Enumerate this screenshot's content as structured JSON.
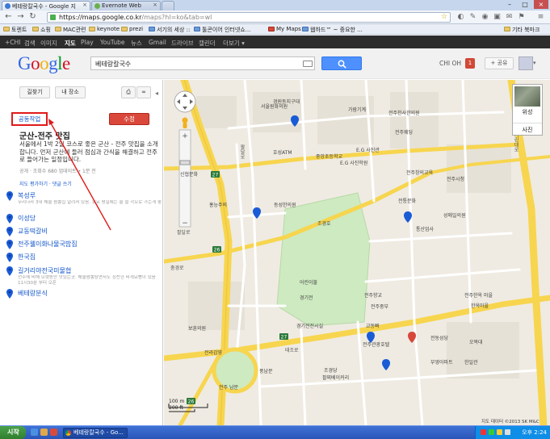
{
  "browser": {
    "tabs": [
      {
        "label": "베테랑칼국수 - Google 지",
        "close": "×"
      },
      {
        "label": "Evernote Web",
        "close": "×"
      }
    ],
    "url_host": "https://maps.google.co.kr",
    "url_path": "/maps?hl=ko&tab=wl",
    "bookmarks": [
      "토렌트",
      "쇼핑",
      "MAC관련",
      "keynote",
      "prezi",
      "서기의 세상 ::",
      "툴콘이어 인터넷쇼...",
      "My Maps",
      "웹하드™ ~ 중요한 ...",
      "기타 북마크"
    ],
    "window_controls": {
      "min": "–",
      "max": "□",
      "close": "×"
    }
  },
  "google_bar": {
    "items": [
      "+CHI",
      "검색",
      "이미지",
      "지도",
      "Play",
      "YouTube",
      "뉴스",
      "Gmail",
      "드라이브",
      "캘린더",
      "더보기 ▾"
    ],
    "active": "지도"
  },
  "header": {
    "logo_letters": [
      "G",
      "o",
      "o",
      "g",
      "l",
      "e"
    ],
    "logo_colors": [
      "#3369e8",
      "#d50f25",
      "#eeb211",
      "#3369e8",
      "#009925",
      "#d50f25"
    ],
    "search_value": "베테랑칼국수",
    "user_name": "CHI OH",
    "notif_count": "1",
    "share_label": "+ 공유"
  },
  "panel": {
    "directions_label": "길찾기",
    "myplaces_label": "내 장소",
    "collab_label": "공동작업",
    "edit_label": "수정",
    "title": "군산-전주 맛집",
    "description": "서울에서 1박 2일 코스로 좋은 군산 - 전주 맛집을 소개합니다. 먼저 군산에 들러 점심과 간식을 해결하고 전주로 들어가는 일정입니다.",
    "meta": "공개 · 조회수 680 업데이트 • 1분 전",
    "links": "지도 평가하기 · 댓글 쓰기",
    "places": [
      {
        "name": "복성루",
        "desc": "우리나라 3대 해물 짬뽕집 알려져 있음. 유유 평일에는 줄 설 각오로 가는게 좋음"
      },
      {
        "name": "이성당",
        "desc": ""
      },
      {
        "name": "교동떡갈비",
        "desc": ""
      },
      {
        "name": "전주웰이화나물국밥집",
        "desc": ""
      },
      {
        "name": "한국집",
        "desc": ""
      },
      {
        "name": "길거리야전국미물협",
        "desc": "전주에 비해 오랫동안 맛있는곳. 해물짬뽕탕면서도 칭찬한 비게요빵이 있음 11시30분 부터 오픈"
      },
      {
        "name": "베테랑분식",
        "desc": ""
      }
    ]
  },
  "map": {
    "type_satellite": "위성",
    "type_photo": "사진",
    "scale_text": "100 m\n200 ft",
    "attribution": "지도 데이터 ©2013 SK M&C",
    "labels": [
      "서울원화의원",
      "경원동지구대",
      "가람기계",
      "전주천사한의원",
      "호성ATM",
      "E.G 사진관",
      "중앙초등학교",
      "전주웨딩",
      "E.G 사진학원",
      "전주창의교육",
      "전주시청",
      "신협문화",
      "홍능주의",
      "조경호",
      "동성한의원",
      "전통문화",
      "성매일의원",
      "통산업사",
      "어린이불",
      "경기전",
      "전주향교",
      "전주한옥 마을",
      "교동빠",
      "태조로",
      "전주중부",
      "한옥마을",
      "경기전전시실",
      "팔달로",
      "기린대로",
      "풍남문",
      "충경로",
      "전주 남문",
      "전주관광호텔",
      "팔찌베이커리",
      "한일관",
      "전동성당",
      "조경당",
      "오목대",
      "팔달로",
      "보훈의원",
      "부영아파트",
      "전라감영"
    ],
    "pin_colors": {
      "blue": "#1a5bd6",
      "red": "#d8483a"
    }
  },
  "taskbar": {
    "start_label": "시작",
    "task_label": "베테랑칼국수 - Go...",
    "clock": "오후 2:24"
  }
}
